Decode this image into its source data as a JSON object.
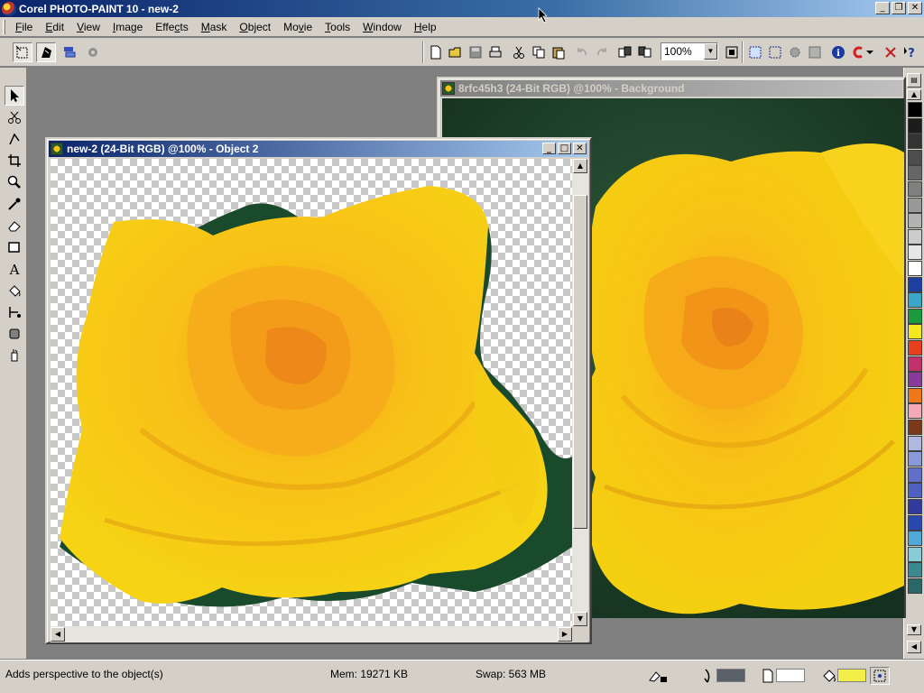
{
  "app": {
    "title": "Corel PHOTO-PAINT 10 - new-2"
  },
  "menu": [
    "File",
    "Edit",
    "View",
    "Image",
    "Effects",
    "Mask",
    "Object",
    "Movie",
    "Tools",
    "Window",
    "Help"
  ],
  "menu_accels": [
    "F",
    "E",
    "V",
    "I",
    "c",
    "M",
    "O",
    "v",
    "T",
    "W",
    "H"
  ],
  "toolbar": {
    "zoom_value": "100%"
  },
  "documents": {
    "front": {
      "title": "new-2 (24-Bit RGB) @100% - Object 2"
    },
    "back": {
      "title": "8rfc45h3 (24-Bit RGB) @100% - Background"
    }
  },
  "palette_colors": [
    "#000000",
    "#1c1c1c",
    "#333333",
    "#4d4d4d",
    "#666666",
    "#808080",
    "#999999",
    "#b3b3b3",
    "#cccccc",
    "#e6e6e6",
    "#ffffff",
    "#1f3fa0",
    "#3aa7c8",
    "#1a9a3a",
    "#f4e81c",
    "#e8401c",
    "#c0306a",
    "#8a3a9a",
    "#f07818",
    "#f4a8b8",
    "#7a3a1a",
    "#b0b8e0",
    "#8898d8",
    "#6070c8",
    "#5060c0",
    "#303a9a",
    "#2848b0",
    "#50a8d8",
    "#88ccd8",
    "#3a8890",
    "#2a6868"
  ],
  "status": {
    "hint": "Adds perspective to the object(s)",
    "mem": "Mem: 19271 KB",
    "swap": "Swap: 563 MB"
  },
  "fills": {
    "outline": "#5a6068",
    "paper": "#ffffff",
    "fill": "#f4ee48"
  }
}
